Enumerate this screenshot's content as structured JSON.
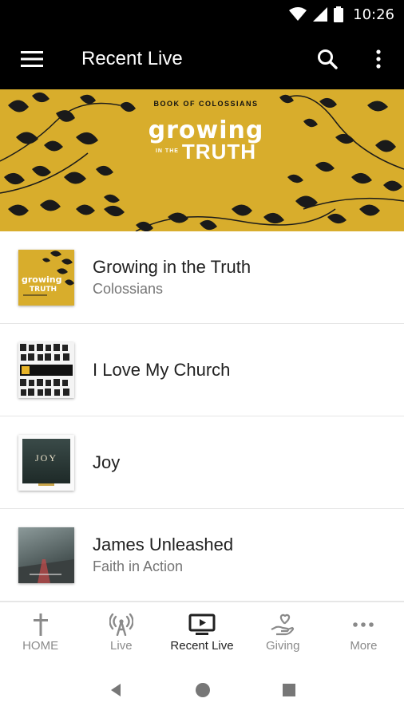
{
  "status_bar": {
    "time": "10:26"
  },
  "app_bar": {
    "title": "Recent Live"
  },
  "banner": {
    "series": "BOOK OF COLOSSIANS",
    "title_line1": "growing",
    "title_small": "IN THE",
    "title_line2": "TRUTH",
    "color": "#d8ad2c"
  },
  "items": [
    {
      "title": "Growing in the Truth",
      "subtitle": "Colossians",
      "thumb": "growing-in-the-truth-art"
    },
    {
      "title": "I Love My Church",
      "subtitle": "",
      "thumb": "i-love-my-church-art"
    },
    {
      "title": "Joy",
      "subtitle": "",
      "thumb": "joy-art",
      "thumb_text": "JOY"
    },
    {
      "title": "James Unleashed",
      "subtitle": "Faith in Action",
      "thumb": "james-unleashed-art"
    }
  ],
  "bottom_nav": [
    {
      "label": "HOME",
      "icon": "cross-icon"
    },
    {
      "label": "Live",
      "icon": "broadcast-icon"
    },
    {
      "label": "Recent Live",
      "icon": "tv-play-icon",
      "active": true
    },
    {
      "label": "Giving",
      "icon": "giving-hand-icon"
    },
    {
      "label": "More",
      "icon": "more-horizontal-icon"
    }
  ]
}
